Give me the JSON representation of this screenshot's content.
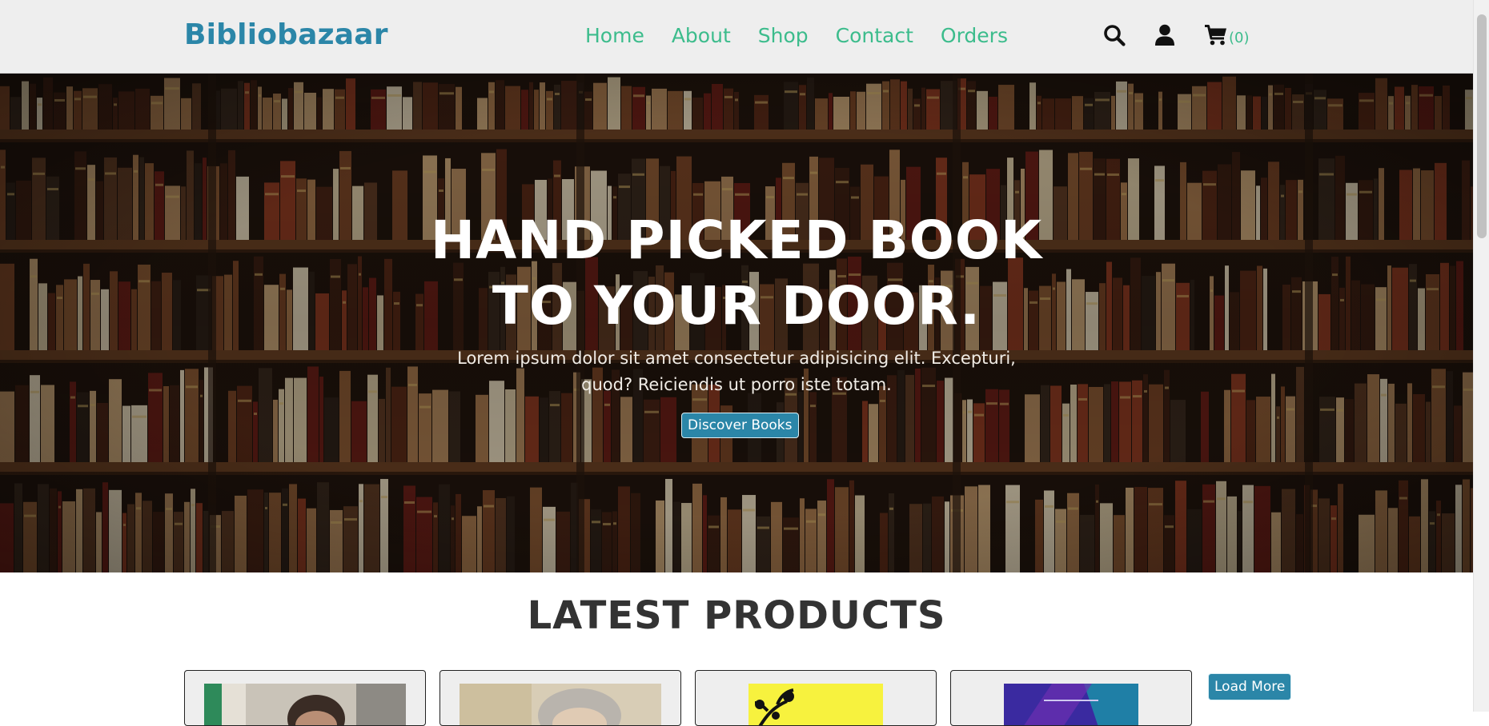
{
  "header": {
    "logo": "Bibliobazaar",
    "nav": [
      "Home",
      "About",
      "Shop",
      "Contact",
      "Orders"
    ],
    "search_icon": "search-icon",
    "user_icon": "user-icon",
    "cart_icon": "cart-icon",
    "cart_count": "(0)"
  },
  "hero": {
    "title_line1": "HAND PICKED BOOK",
    "title_line2": "TO YOUR DOOR.",
    "description_line1": "Lorem ipsum dolor sit amet consectetur adipisicing elit. Excepturi,",
    "description_line2": "quod? Reiciendis ut porro iste totam.",
    "button": "Discover Books"
  },
  "latest": {
    "title": "LATEST PRODUCTS",
    "load_more": "Load More",
    "cards": [
      "product-1",
      "product-2",
      "product-3",
      "product-4"
    ]
  },
  "colors": {
    "brand": "#2b86a8",
    "nav": "#3cbc8c",
    "header_bg": "#eeeeee"
  }
}
